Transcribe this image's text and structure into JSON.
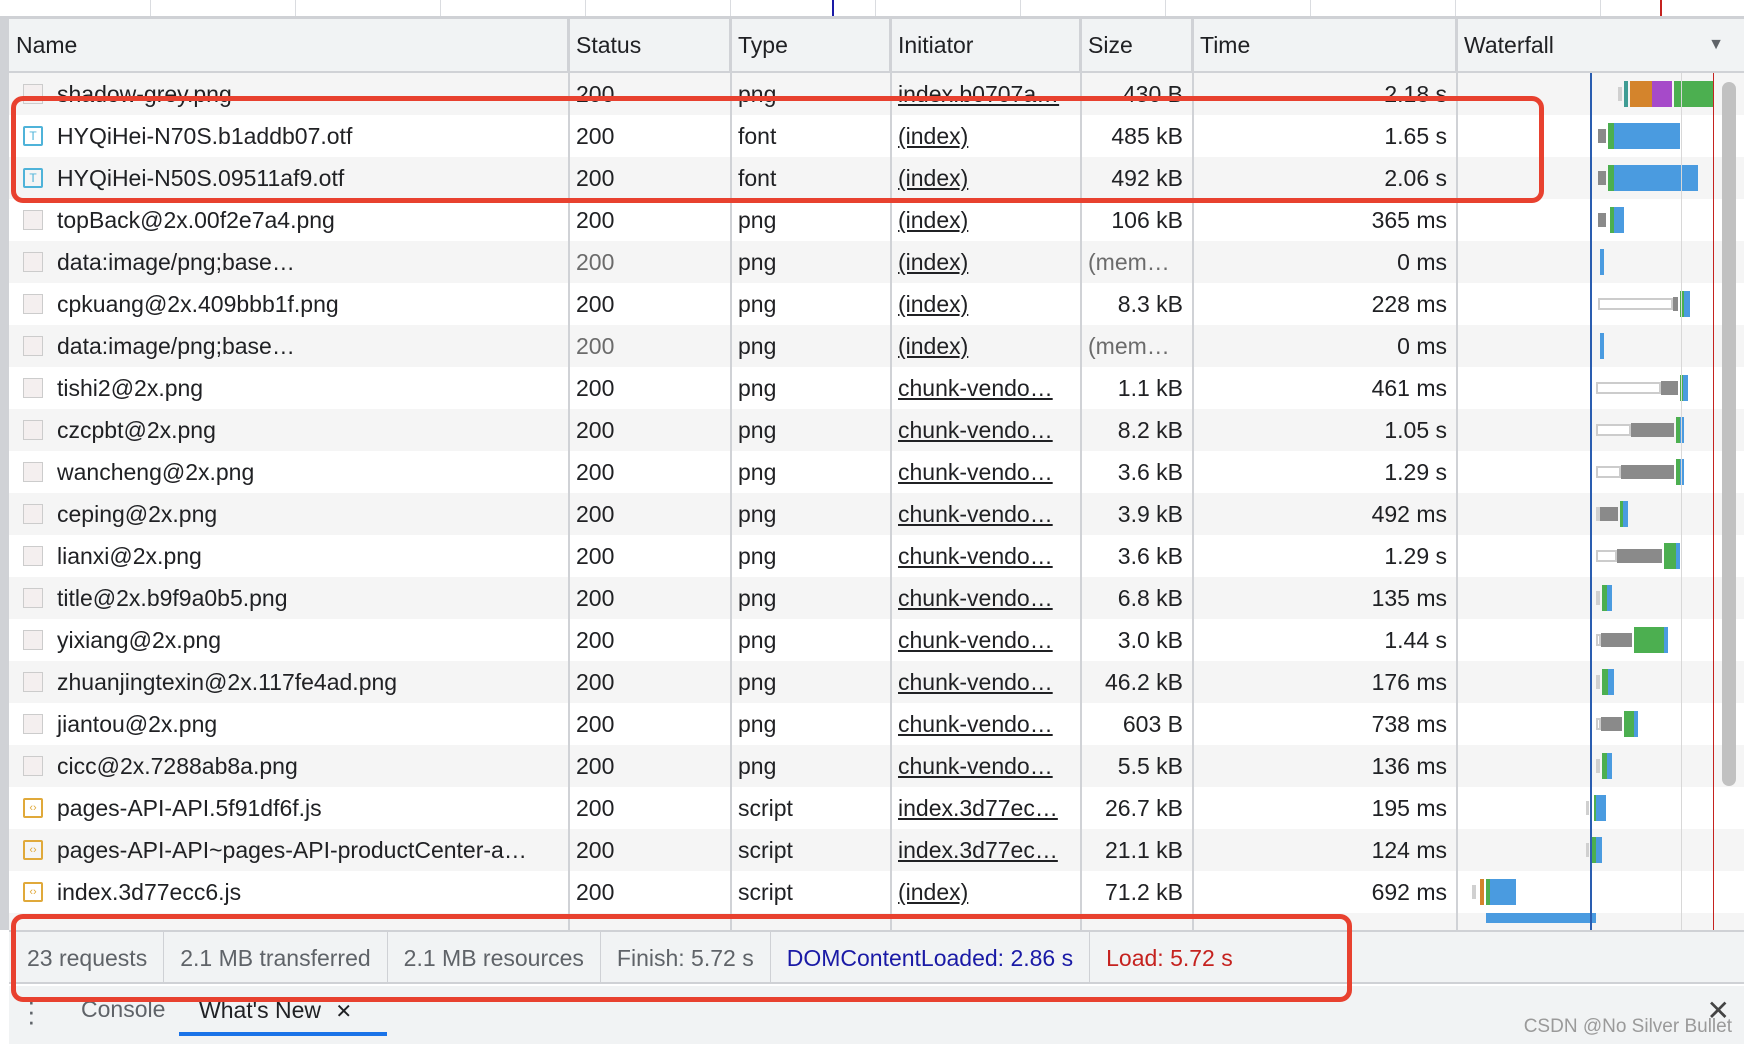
{
  "columns": [
    "Name",
    "Status",
    "Type",
    "Initiator",
    "Size",
    "Time",
    "Waterfall"
  ],
  "waterfall_dropdown_icon": "triangle-down-icon",
  "rows": [
    {
      "name": "shadow-grey.png",
      "status": "200",
      "type": "png",
      "initiator": "index.b0707a…",
      "size": "430 B",
      "time": "2.18 s",
      "icon": "image-icon"
    },
    {
      "name": "HYQiHei-N70S.b1addb07.otf",
      "status": "200",
      "type": "font",
      "initiator": "(index)",
      "size": "485 kB",
      "time": "1.65 s",
      "icon": "font-icon"
    },
    {
      "name": "HYQiHei-N50S.09511af9.otf",
      "status": "200",
      "type": "font",
      "initiator": "(index)",
      "size": "492 kB",
      "time": "2.06 s",
      "icon": "font-icon"
    },
    {
      "name": "topBack@2x.00f2e7a4.png",
      "status": "200",
      "type": "png",
      "initiator": "(index)",
      "size": "106 kB",
      "time": "365 ms",
      "icon": "image-icon"
    },
    {
      "name": "data:image/png;base…",
      "status": "200",
      "type": "png",
      "initiator": "(index)",
      "size": "(mem…",
      "time": "0 ms",
      "icon": "image-icon",
      "dim": true
    },
    {
      "name": "cpkuang@2x.409bbb1f.png",
      "status": "200",
      "type": "png",
      "initiator": "(index)",
      "size": "8.3 kB",
      "time": "228 ms",
      "icon": "image-icon"
    },
    {
      "name": "data:image/png;base…",
      "status": "200",
      "type": "png",
      "initiator": "(index)",
      "size": "(mem…",
      "time": "0 ms",
      "icon": "image-icon",
      "dim": true
    },
    {
      "name": "tishi2@2x.png",
      "status": "200",
      "type": "png",
      "initiator": "chunk-vendo…",
      "size": "1.1 kB",
      "time": "461 ms",
      "icon": "image-icon"
    },
    {
      "name": "czcpbt@2x.png",
      "status": "200",
      "type": "png",
      "initiator": "chunk-vendo…",
      "size": "8.2 kB",
      "time": "1.05 s",
      "icon": "image-icon"
    },
    {
      "name": "wancheng@2x.png",
      "status": "200",
      "type": "png",
      "initiator": "chunk-vendo…",
      "size": "3.6 kB",
      "time": "1.29 s",
      "icon": "image-icon"
    },
    {
      "name": "ceping@2x.png",
      "status": "200",
      "type": "png",
      "initiator": "chunk-vendo…",
      "size": "3.9 kB",
      "time": "492 ms",
      "icon": "image-icon"
    },
    {
      "name": "lianxi@2x.png",
      "status": "200",
      "type": "png",
      "initiator": "chunk-vendo…",
      "size": "3.6 kB",
      "time": "1.29 s",
      "icon": "image-icon"
    },
    {
      "name": "title@2x.b9f9a0b5.png",
      "status": "200",
      "type": "png",
      "initiator": "chunk-vendo…",
      "size": "6.8 kB",
      "time": "135 ms",
      "icon": "image-icon"
    },
    {
      "name": "yixiang@2x.png",
      "status": "200",
      "type": "png",
      "initiator": "chunk-vendo…",
      "size": "3.0 kB",
      "time": "1.44 s",
      "icon": "image-icon"
    },
    {
      "name": "zhuanjingtexin@2x.117fe4ad.png",
      "status": "200",
      "type": "png",
      "initiator": "chunk-vendo…",
      "size": "46.2 kB",
      "time": "176 ms",
      "icon": "image-icon"
    },
    {
      "name": "jiantou@2x.png",
      "status": "200",
      "type": "png",
      "initiator": "chunk-vendo…",
      "size": "603 B",
      "time": "738 ms",
      "icon": "image-icon"
    },
    {
      "name": "cicc@2x.7288ab8a.png",
      "status": "200",
      "type": "png",
      "initiator": "chunk-vendo…",
      "size": "5.5 kB",
      "time": "136 ms",
      "icon": "image-icon"
    },
    {
      "name": "pages-API-API.5f91df6f.js",
      "status": "200",
      "type": "script",
      "initiator": "index.3d77ec…",
      "size": "26.7 kB",
      "time": "195 ms",
      "icon": "script-icon"
    },
    {
      "name": "pages-API-API~pages-API-productCenter-a…",
      "status": "200",
      "type": "script",
      "initiator": "index.3d77ec…",
      "size": "21.1 kB",
      "time": "124 ms",
      "icon": "script-icon"
    },
    {
      "name": "index.3d77ecc6.js",
      "status": "200",
      "type": "script",
      "initiator": "(index)",
      "size": "71.2 kB",
      "time": "692 ms",
      "icon": "script-icon"
    }
  ],
  "summary": {
    "requests": "23 requests",
    "transferred": "2.1 MB transferred",
    "resources": "2.1 MB resources",
    "finish": "Finish: 5.72 s",
    "dcl": "DOMContentLoaded: 2.86 s",
    "load": "Load: 5.72 s"
  },
  "drawer": {
    "tabs": [
      "Console",
      "What's New"
    ],
    "active": "What's New",
    "close": "✕",
    "tab_close": "✕"
  },
  "watermark": "CSDN @No Silver Bullet",
  "colors": {
    "dcl": "#1a1aa6",
    "load": "#c5221f",
    "annotation": "#e8412f",
    "blue": "#4a9be0",
    "green": "#4caf50"
  }
}
